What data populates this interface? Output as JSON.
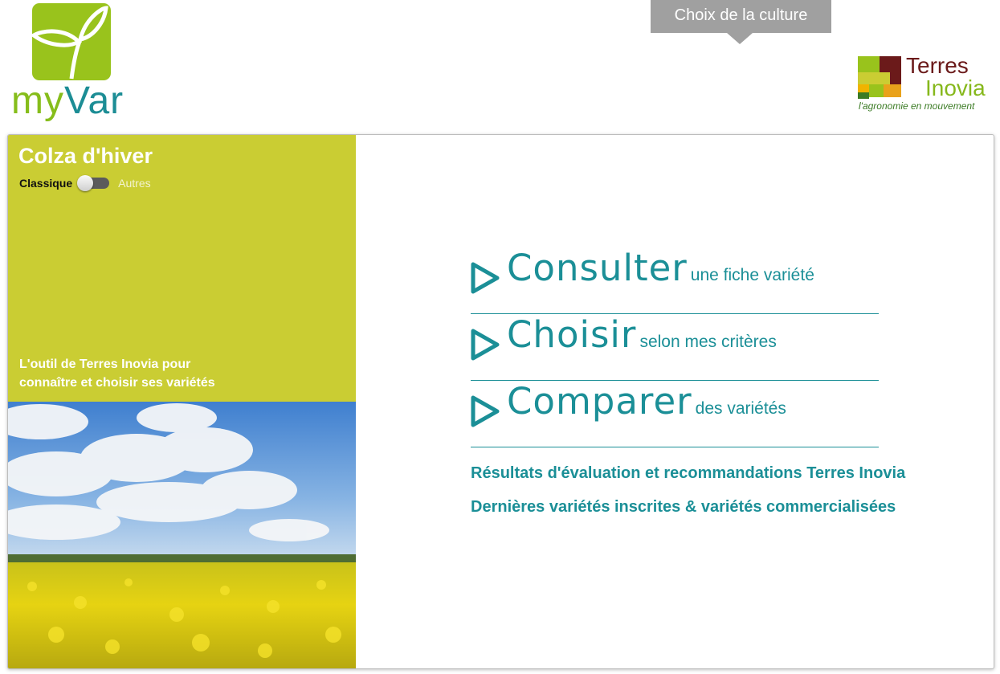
{
  "brand": {
    "myvar_prefix": "my",
    "myvar_suffix": "Var",
    "partner_line1": "Terres",
    "partner_line2": "Inovia",
    "partner_tagline": "l'agronomie en mouvement"
  },
  "tooltip": {
    "label": "Choix de la culture"
  },
  "sidebar": {
    "crop_title": "Colza d'hiver",
    "toggle": {
      "left_label": "Classique",
      "right_label": "Autres",
      "state": "Classique"
    },
    "tagline_line1": "L'outil de Terres Inovia pour",
    "tagline_line2": "connaître et choisir ses variétés"
  },
  "menu": {
    "items": [
      {
        "big": "Consulter",
        "small": "une fiche variété"
      },
      {
        "big": "Choisir",
        "small": "selon mes critères"
      },
      {
        "big": "Comparer",
        "small": "des variétés"
      }
    ]
  },
  "links": {
    "results": "Résultats d'évaluation et recommandations Terres Inovia",
    "latest": "Dernières variétés inscrites & variétés commercialisées"
  },
  "colors": {
    "accent_teal": "#1b8f97",
    "sidebar_green": "#cacd33",
    "logo_green": "#99c31c"
  }
}
